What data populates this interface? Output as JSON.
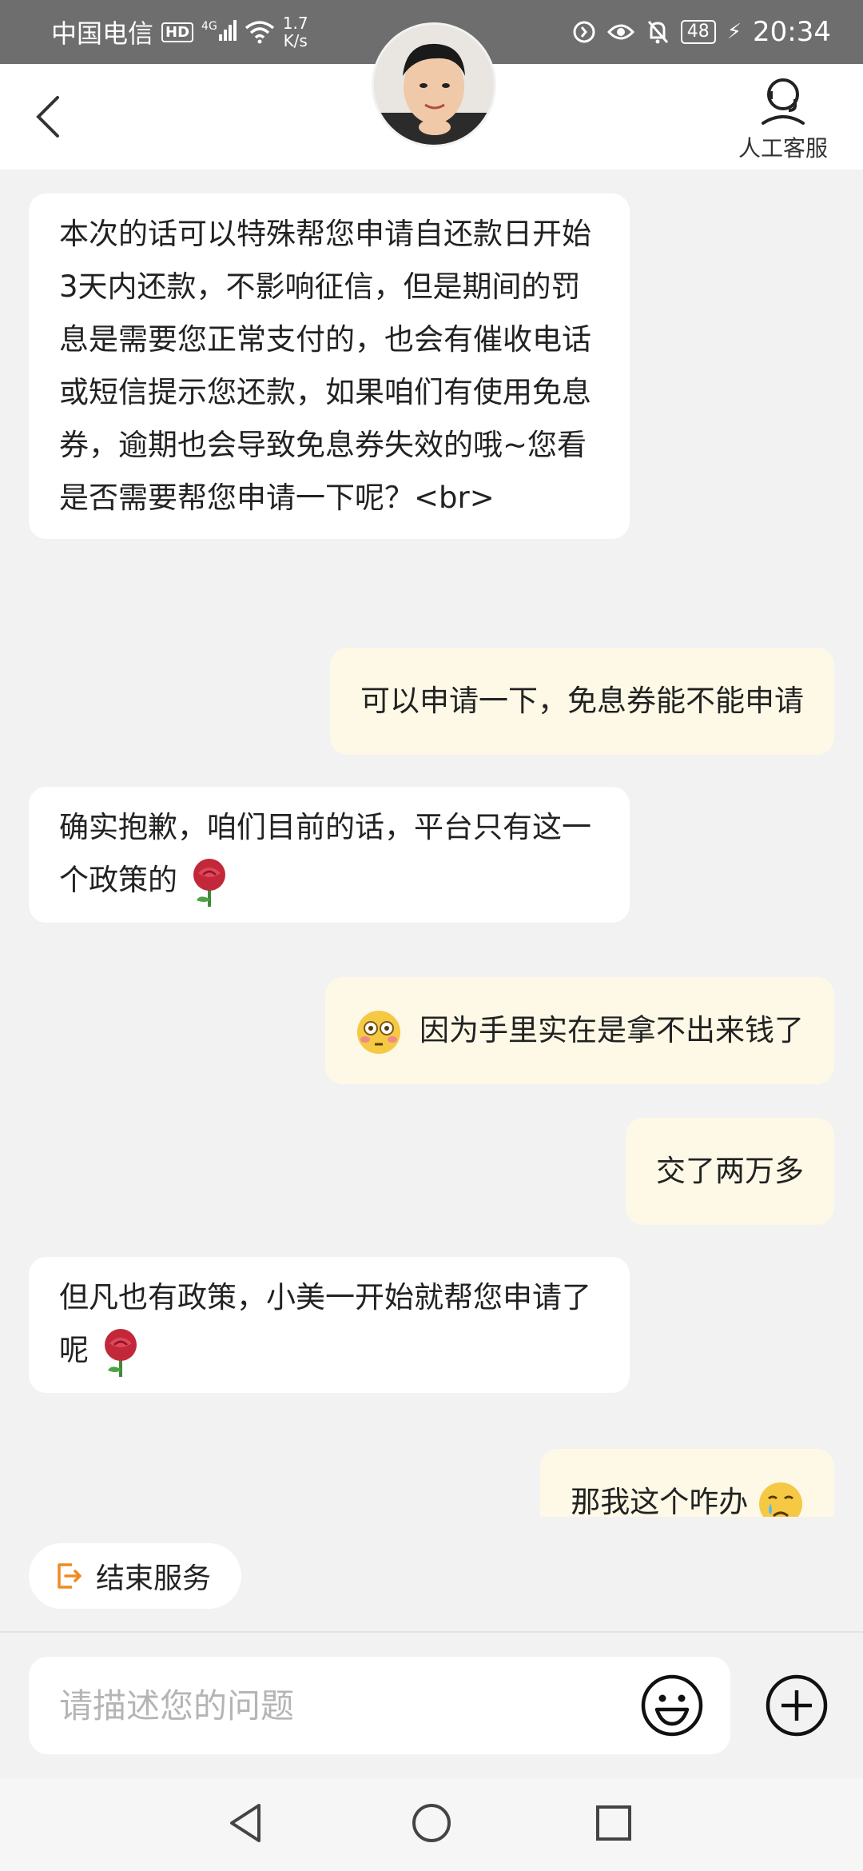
{
  "status_bar": {
    "carrier": "中国电信",
    "hd": "HD",
    "signal_tag": "4G",
    "net_speed_value": "1.7",
    "net_speed_unit": "K/s",
    "battery": "48",
    "time": "20:34"
  },
  "header": {
    "agent_label": "人工客服"
  },
  "messages": [
    {
      "side": "left",
      "text": "本次的话可以特殊帮您申请自还款日开始3天内还款，不影响征信，但是期间的罚息是需要您正常支付的，也会有催收电话或短信提示您还款，如果咱们有使用免息券，逾期也会导致免息券失效的哦~您看是否需要帮您申请一下呢？<br>"
    },
    {
      "side": "right",
      "text": "可以申请一下，免息券能不能申请"
    },
    {
      "side": "left",
      "text": "确实抱歉，咱们目前的话，平台只有这一个政策的",
      "emoji": "rose-icon"
    },
    {
      "side": "right",
      "text": "因为手里实在是拿不出来钱了",
      "emoji_before": "flushed-face-icon"
    },
    {
      "side": "right",
      "text": "交了两万多"
    },
    {
      "side": "left",
      "text": "但凡也有政策，小美一开始就帮您申请了呢",
      "emoji": "rose-icon"
    },
    {
      "side": "right",
      "text": "那我这个咋办",
      "emoji": "crying-face-icon"
    }
  ],
  "end_service": {
    "label": "结束服务",
    "icon": "exit-icon"
  },
  "composer": {
    "placeholder": "请描述您的问题",
    "emoji_button_icon": "smiley-icon",
    "plus_button_icon": "plus-circle-icon"
  },
  "colors": {
    "accent_orange": "#f08a24",
    "right_bubble_bg": "#fdf9e6",
    "left_bubble_bg": "#ffffff",
    "status_bar_bg": "#6e6e6e"
  }
}
